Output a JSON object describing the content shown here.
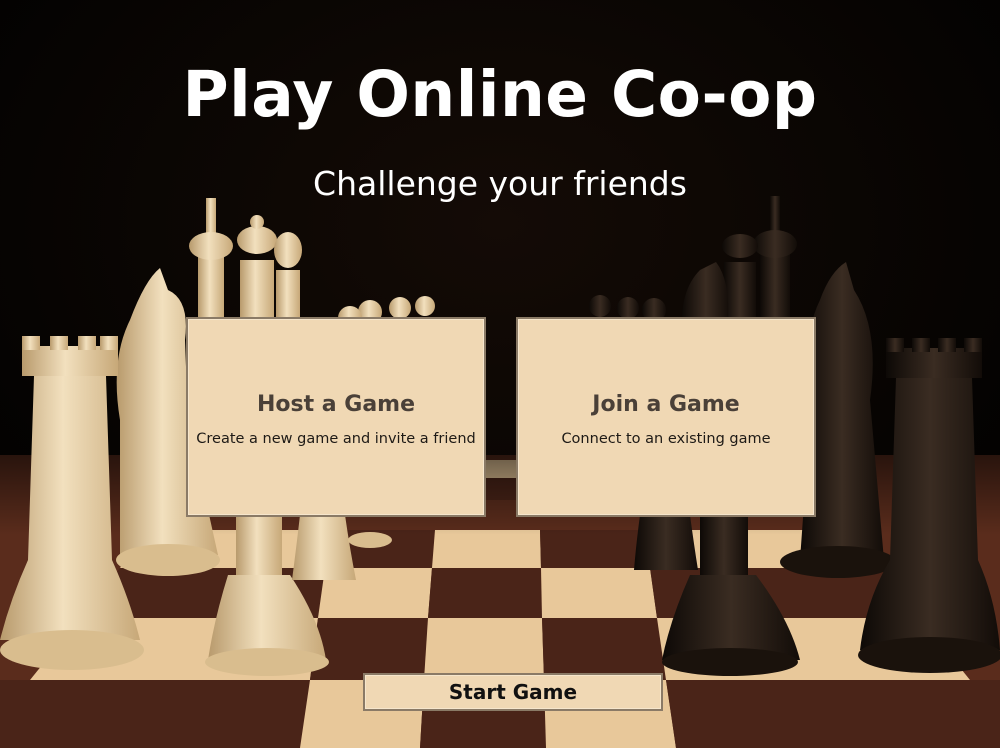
{
  "header": {
    "title": "Play Online Co-op",
    "subtitle": "Challenge your friends"
  },
  "cards": {
    "host": {
      "title": "Host a Game",
      "description": "Create a new game and invite a friend"
    },
    "join": {
      "title": "Join a Game",
      "description": "Connect to an existing game"
    }
  },
  "actions": {
    "start_label": "Start Game"
  },
  "colors": {
    "panel": "#f0d8b4",
    "panel_border": "#8a7a66",
    "card_title": "#4a4038",
    "background": "#050302",
    "light_square": "#e8c89a",
    "dark_square": "#4a2418",
    "light_piece": "#e6cfa6",
    "dark_piece": "#1c1410"
  },
  "icons": {
    "background_scene": "chess-board-icon"
  }
}
